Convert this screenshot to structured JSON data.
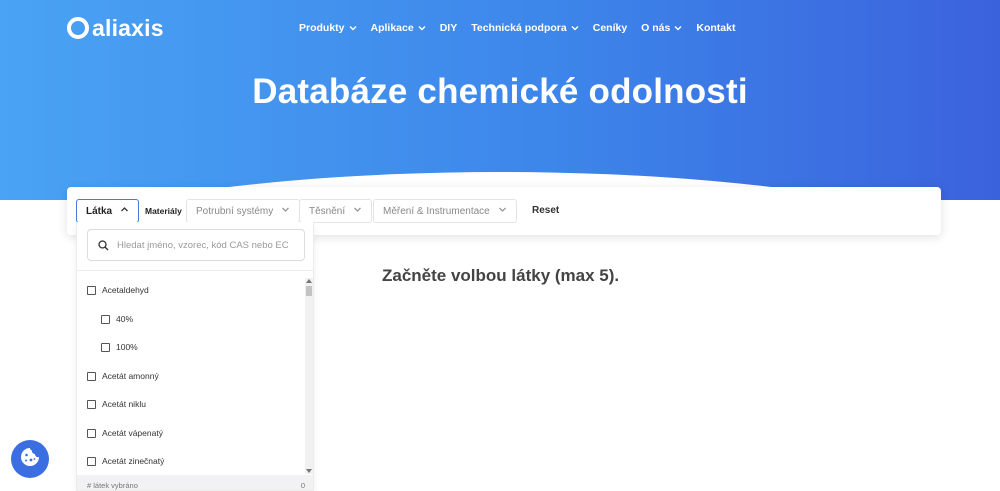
{
  "brand": {
    "name": "aliaxis"
  },
  "nav": {
    "items": [
      {
        "label": "Produkty",
        "has_dropdown": true
      },
      {
        "label": "Aplikace",
        "has_dropdown": true
      },
      {
        "label": "DIY",
        "has_dropdown": false
      },
      {
        "label": "Technická podpora",
        "has_dropdown": true
      },
      {
        "label": "Ceníky",
        "has_dropdown": false
      },
      {
        "label": "O nás",
        "has_dropdown": true
      },
      {
        "label": "Kontakt",
        "has_dropdown": false
      }
    ]
  },
  "hero": {
    "title": "Databáze chemické odolnosti"
  },
  "filters": {
    "substance_label": "Látka",
    "materials_label": "Materiály",
    "pipe_systems_label": "Potrubní systémy",
    "seals_label": "Těsnění",
    "measurement_label": "Měření & Instrumentace",
    "reset_label": "Reset"
  },
  "dropdown": {
    "search_placeholder": "Hledat jméno, vzorec, kód CAS nebo EC",
    "items": [
      {
        "label": "Acetaldehyd",
        "level": 0,
        "checked": false
      },
      {
        "label": "40%",
        "level": 1,
        "checked": false
      },
      {
        "label": "100%",
        "level": 1,
        "checked": false
      },
      {
        "label": "Acetát amonný",
        "level": 0,
        "checked": false
      },
      {
        "label": "Acetát niklu",
        "level": 0,
        "checked": false
      },
      {
        "label": "Acetát vápenatý",
        "level": 0,
        "checked": false
      },
      {
        "label": "Acetát zinečnatý",
        "level": 0,
        "checked": false
      }
    ],
    "selected_count_label": "# látek vybráno",
    "selected_count": "0"
  },
  "main": {
    "empty_message": "Začněte volbou látky (max 5)."
  },
  "colors": {
    "hero_gradient_start": "#4aa3f4",
    "hero_gradient_end": "#3b62dd",
    "accent": "#3b6ee0",
    "active_border": "#4a78d8"
  },
  "icons": {
    "chevron": "chevron-down-icon",
    "chevron_up": "chevron-up-icon",
    "search": "search-icon",
    "cookie": "cookie-icon"
  }
}
